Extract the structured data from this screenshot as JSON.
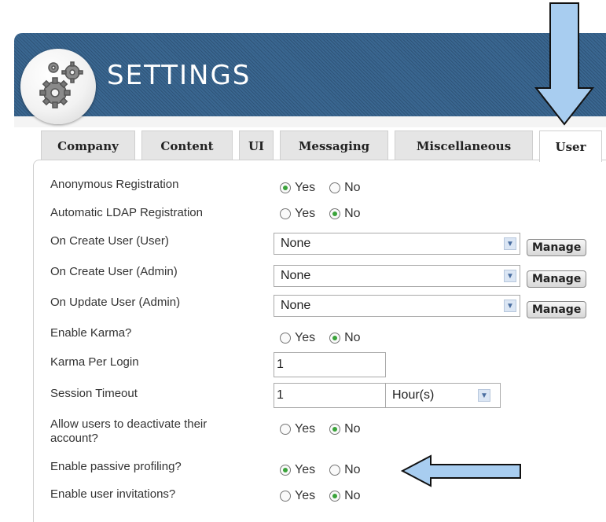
{
  "header": {
    "title": "SETTINGS",
    "logo_icon": "gears-icon"
  },
  "tabs": [
    {
      "label": "Company",
      "active": false
    },
    {
      "label": "Content",
      "active": false
    },
    {
      "label": "UI",
      "active": false
    },
    {
      "label": "Messaging",
      "active": false
    },
    {
      "label": "Miscellaneous",
      "active": false
    },
    {
      "label": "User",
      "active": true
    }
  ],
  "settings": {
    "anonymous_registration": {
      "label": "Anonymous Registration",
      "yes": "Yes",
      "no": "No",
      "selected": "Yes"
    },
    "automatic_ldap_registration": {
      "label": "Automatic LDAP Registration",
      "yes": "Yes",
      "no": "No",
      "selected": "No"
    },
    "on_create_user_user": {
      "label": "On Create User (User)",
      "value": "None",
      "manage": "Manage"
    },
    "on_create_user_admin": {
      "label": "On Create User (Admin)",
      "value": "None",
      "manage": "Manage"
    },
    "on_update_user_admin": {
      "label": "On Update User (Admin)",
      "value": "None",
      "manage": "Manage"
    },
    "enable_karma": {
      "label": "Enable Karma?",
      "yes": "Yes",
      "no": "No",
      "selected": "No"
    },
    "karma_per_login": {
      "label": "Karma Per Login",
      "value": "1"
    },
    "session_timeout": {
      "label": "Session Timeout",
      "value": "1",
      "unit": "Hour(s)"
    },
    "allow_deactivate": {
      "label_line1": "Allow users to deactivate their",
      "label_line2": "account?",
      "yes": "Yes",
      "no": "No",
      "selected": "No"
    },
    "enable_passive_profiling": {
      "label": "Enable passive profiling?",
      "yes": "Yes",
      "no": "No",
      "selected": "Yes"
    },
    "enable_user_invitations": {
      "label": "Enable user invitations?",
      "yes": "Yes",
      "no": "No",
      "selected": "No"
    }
  },
  "annotations": {
    "arrow_color": "#a8cdf0",
    "arrow_stroke": "#111111"
  },
  "colors": {
    "header_blue": "#3a6791",
    "radio_checked": "#3aa33a"
  }
}
